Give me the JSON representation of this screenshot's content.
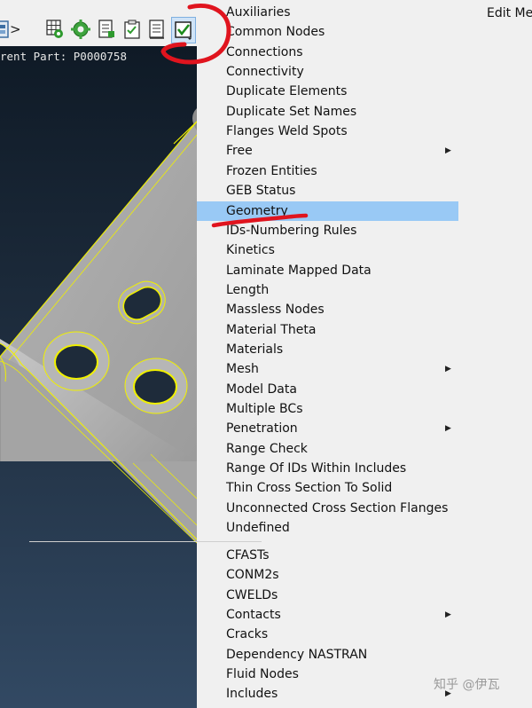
{
  "viewport": {
    "current_part_label": "rent Part: P0000758"
  },
  "right_menu": {
    "edit_menu_label": "Edit Me"
  },
  "menu": {
    "items_group1": [
      {
        "label": "Auxiliaries",
        "submenu": false
      },
      {
        "label": "Common Nodes",
        "submenu": false
      },
      {
        "label": "Connections",
        "submenu": false
      },
      {
        "label": "Connectivity",
        "submenu": false
      },
      {
        "label": "Duplicate Elements",
        "submenu": false
      },
      {
        "label": "Duplicate Set Names",
        "submenu": false
      },
      {
        "label": "Flanges Weld Spots",
        "submenu": false
      },
      {
        "label": "Free",
        "submenu": true
      },
      {
        "label": "Frozen Entities",
        "submenu": false
      },
      {
        "label": "GEB Status",
        "submenu": false
      },
      {
        "label": "Geometry",
        "submenu": false,
        "highlighted": true
      },
      {
        "label": "IDs-Numbering Rules",
        "submenu": false
      },
      {
        "label": "Kinetics",
        "submenu": false
      },
      {
        "label": "Laminate Mapped Data",
        "submenu": false
      },
      {
        "label": "Length",
        "submenu": false
      },
      {
        "label": "Massless Nodes",
        "submenu": false
      },
      {
        "label": "Material Theta",
        "submenu": false
      },
      {
        "label": "Materials",
        "submenu": false
      },
      {
        "label": "Mesh",
        "submenu": true
      },
      {
        "label": "Model Data",
        "submenu": false
      },
      {
        "label": "Multiple BCs",
        "submenu": false
      },
      {
        "label": "Penetration",
        "submenu": true
      },
      {
        "label": "Range Check",
        "submenu": false
      },
      {
        "label": "Range Of IDs Within Includes",
        "submenu": false
      },
      {
        "label": "Thin Cross Section To Solid",
        "submenu": false
      },
      {
        "label": "Unconnected Cross Section Flanges",
        "submenu": false
      },
      {
        "label": "Undefined",
        "submenu": false
      }
    ],
    "items_group2": [
      {
        "label": "CFASTs",
        "submenu": false
      },
      {
        "label": "CONM2s",
        "submenu": false
      },
      {
        "label": "CWELDs",
        "submenu": false
      },
      {
        "label": "Contacts",
        "submenu": true
      },
      {
        "label": "Cracks",
        "submenu": false
      },
      {
        "label": "Dependency NASTRAN",
        "submenu": false
      },
      {
        "label": "Fluid Nodes",
        "submenu": false
      },
      {
        "label": "Includes",
        "submenu": true
      }
    ]
  },
  "toolbar": {
    "icons": [
      "panel-icon",
      "chevron-right-icon",
      "grid-gear-icon",
      "gear-green-icon",
      "doc-list-icon",
      "clipboard-check-icon",
      "doc-lines-icon",
      "checkbox-checked-icon"
    ]
  },
  "watermark": "知乎 @伊瓦",
  "colors": {
    "highlight": "#99c9f5",
    "annotation_red": "#e0141e",
    "edge_yellow": "#f0f000",
    "part_gray": "#a9a9a9"
  }
}
